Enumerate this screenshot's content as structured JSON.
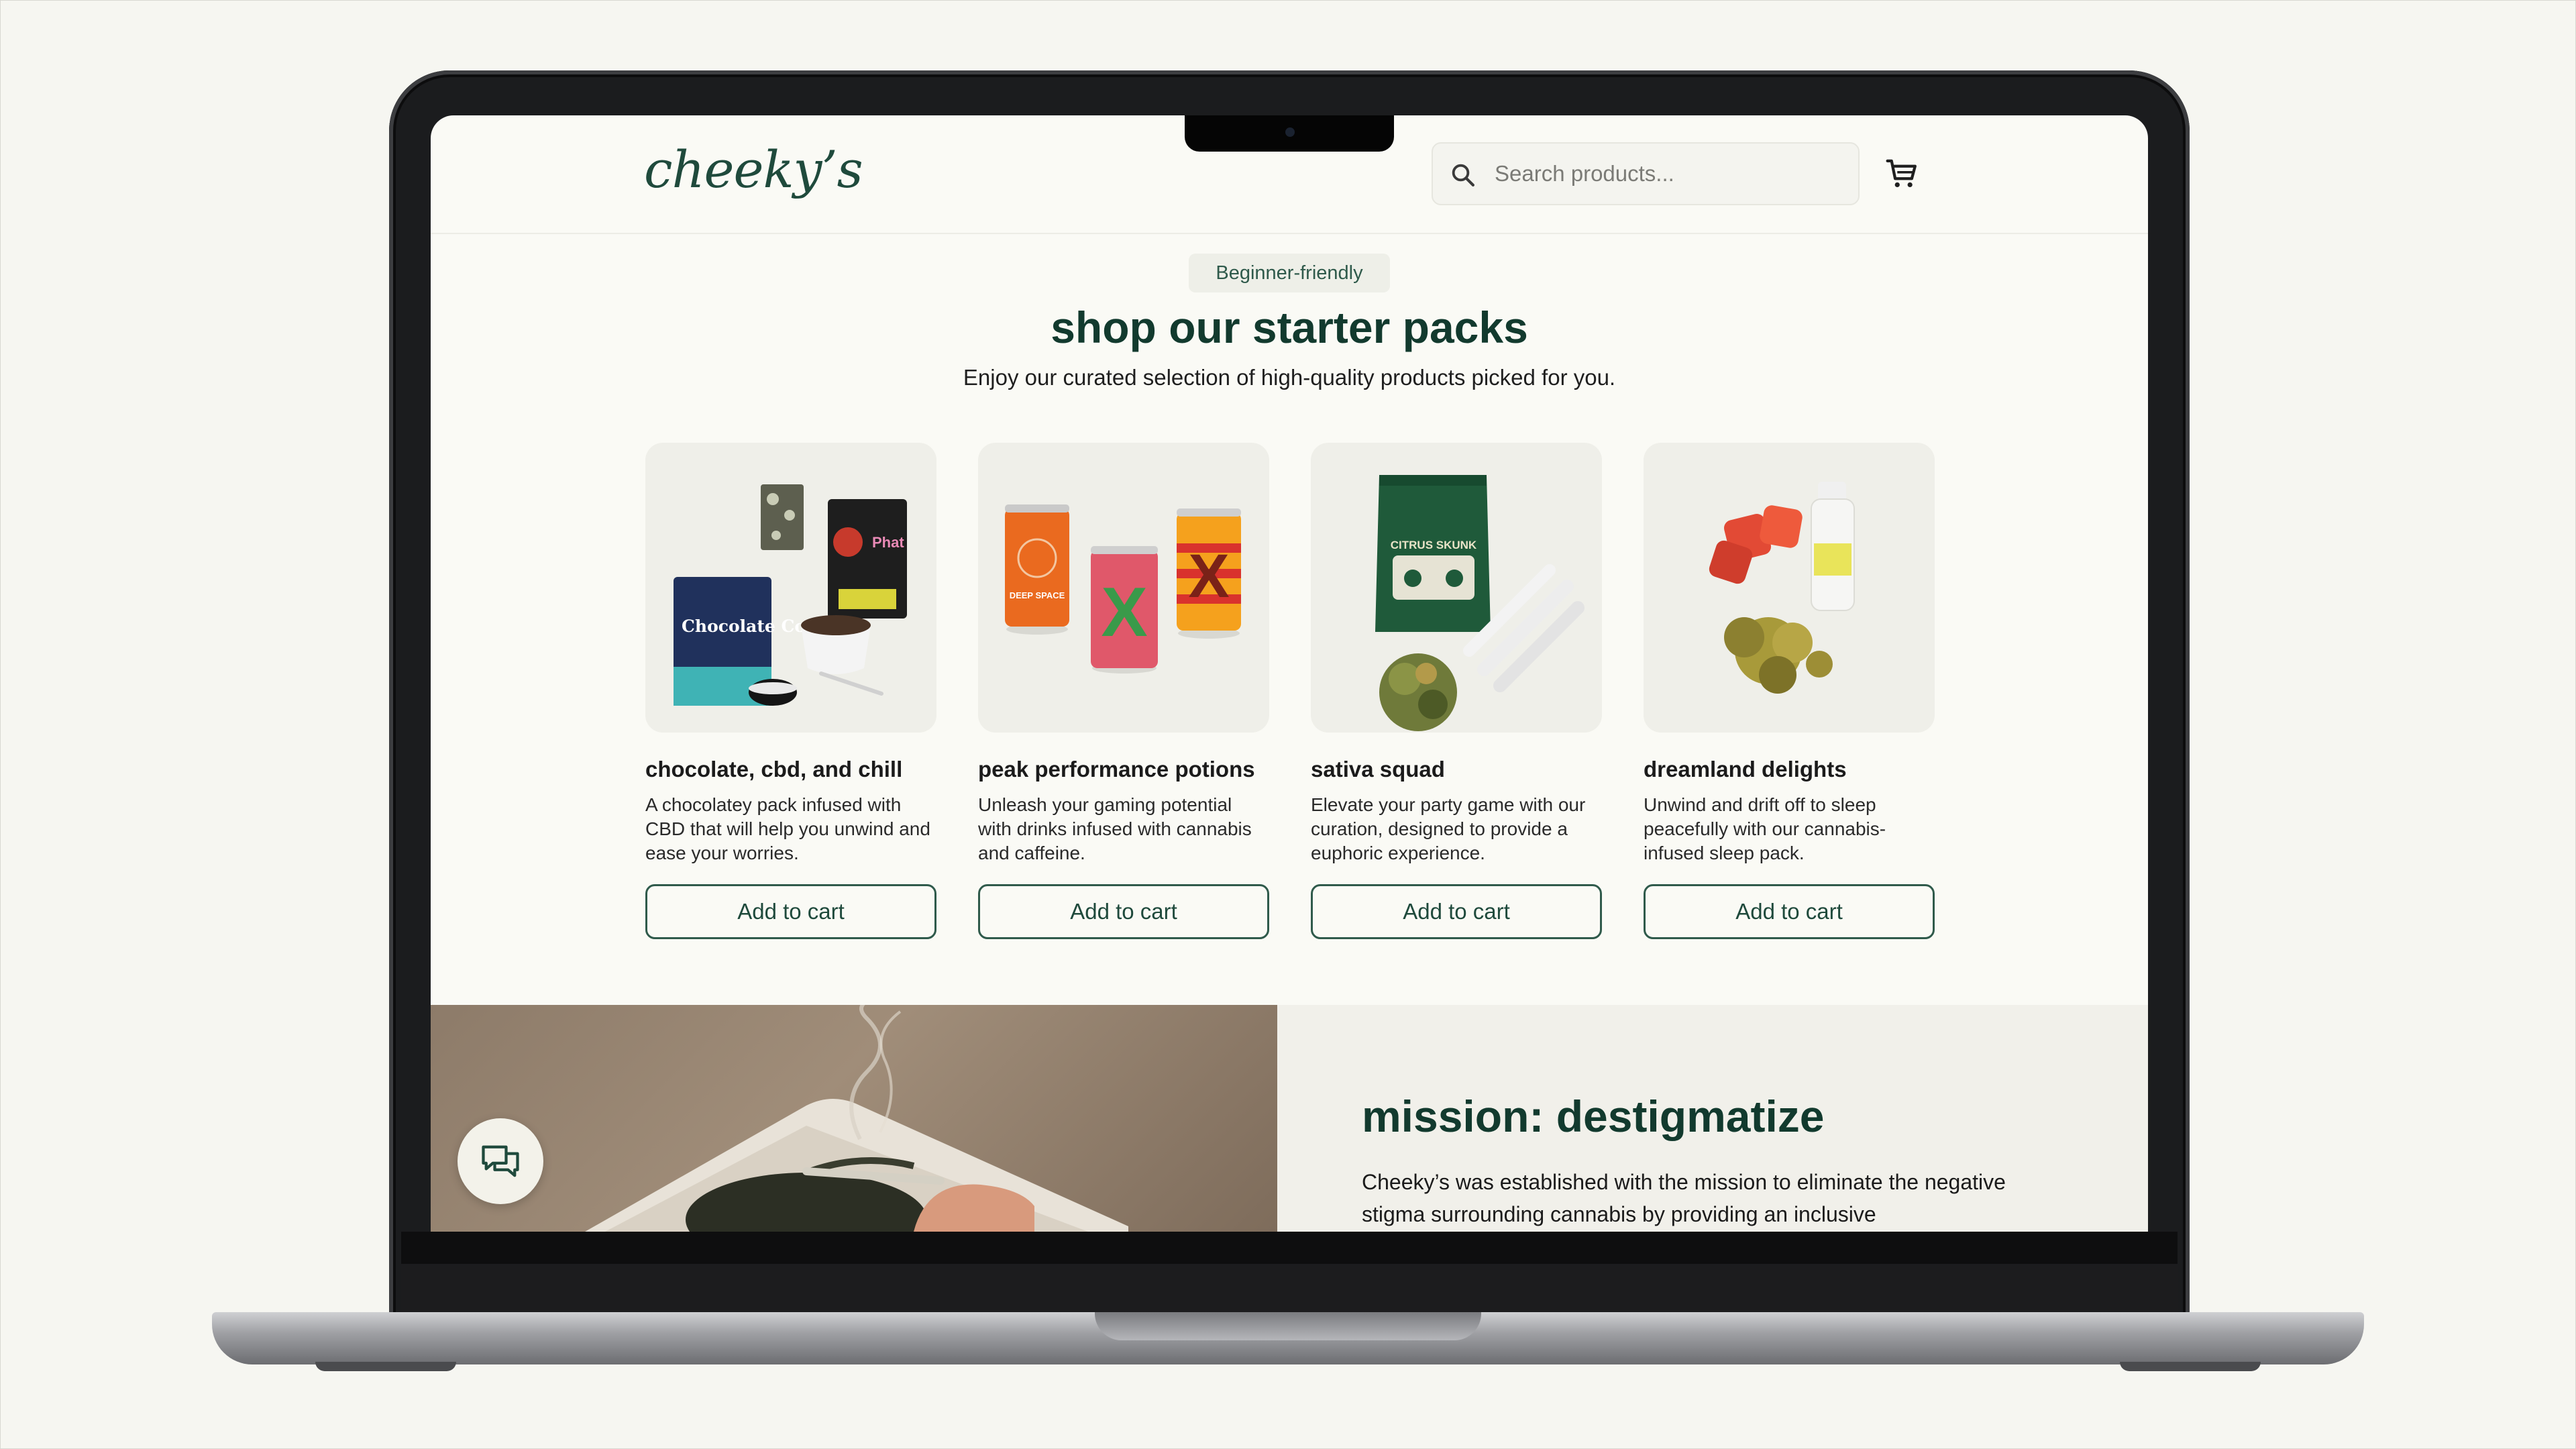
{
  "site": {
    "logo": "cheeky’s",
    "search": {
      "placeholder": "Search products..."
    }
  },
  "starter": {
    "badge": "Beginner-friendly",
    "title": "shop our starter packs",
    "subtitle": "Enjoy our curated selection of high-quality products picked for you.",
    "products": [
      {
        "name": "chocolate, cbd, and chill",
        "description": "A chocolatey pack infused with CBD that will help you unwind and ease your worries.",
        "button": "Add to cart"
      },
      {
        "name": "peak performance potions",
        "description": "Unleash your gaming potential with drinks infused with cannabis and caffeine.",
        "button": "Add to cart"
      },
      {
        "name": "sativa squad",
        "description": "Elevate your party game with our curation, designed to provide a euphoric experience.",
        "button": "Add to cart"
      },
      {
        "name": "dreamland delights",
        "description": "Unwind and drift off to sleep peacefully with our cannabis-infused sleep pack.",
        "button": "Add to cart"
      }
    ]
  },
  "mission": {
    "title": "mission: destigmatize",
    "text": "Cheeky’s was established with the mission to eliminate the negative stigma surrounding cannabis by providing an inclusive"
  },
  "product_art": {
    "bag_label": "Chocolate Cookie",
    "bag_brand": "Phat",
    "can_brand": "DEEP SPACE",
    "can_letter": "X",
    "pouch_label": "CITRUS SKUNK"
  },
  "colors": {
    "brand_green": "#1f4a3c",
    "heading_green": "#123a2e",
    "page_background": "#fafaf5",
    "card_background": "#efefe9"
  },
  "icons": {
    "search": "search-icon",
    "cart": "cart-icon",
    "chat": "chat-icon"
  }
}
